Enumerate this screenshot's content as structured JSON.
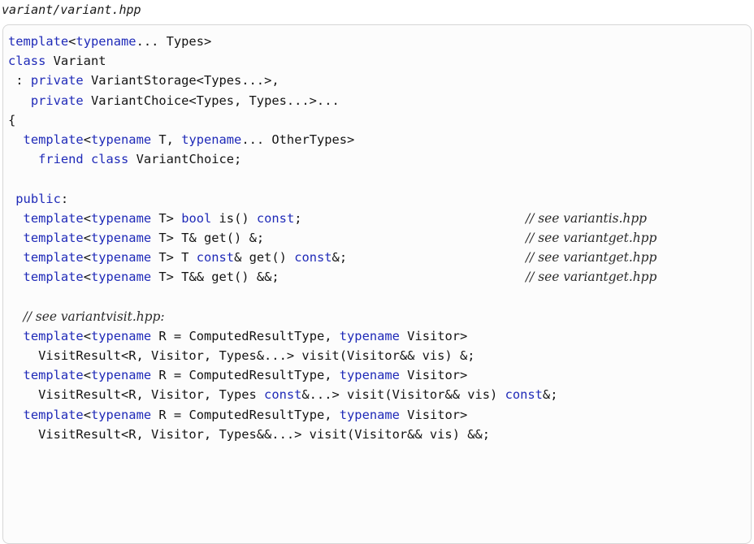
{
  "file": {
    "name": "variant/variant.hpp"
  },
  "code_lines": [
    [
      {
        "t": "template",
        "k": "kw"
      },
      {
        "t": "<",
        "k": "p"
      },
      {
        "t": "typename",
        "k": "kw"
      },
      {
        "t": "... Types>",
        "k": "p"
      }
    ],
    [
      {
        "t": "class",
        "k": "kw"
      },
      {
        "t": " Variant",
        "k": "p"
      }
    ],
    [
      {
        "t": " : ",
        "k": "p"
      },
      {
        "t": "private",
        "k": "kw"
      },
      {
        "t": " VariantStorage<Types...>,",
        "k": "p"
      }
    ],
    [
      {
        "t": "   ",
        "k": "p"
      },
      {
        "t": "private",
        "k": "kw"
      },
      {
        "t": " VariantChoice<Types, Types...>...",
        "k": "p"
      }
    ],
    [
      {
        "t": "{",
        "k": "p"
      }
    ],
    [
      {
        "t": "  ",
        "k": "p"
      },
      {
        "t": "template",
        "k": "kw"
      },
      {
        "t": "<",
        "k": "p"
      },
      {
        "t": "typename",
        "k": "kw"
      },
      {
        "t": " T, ",
        "k": "p"
      },
      {
        "t": "typename",
        "k": "kw"
      },
      {
        "t": "... OtherTypes>",
        "k": "p"
      }
    ],
    [
      {
        "t": "    ",
        "k": "p"
      },
      {
        "t": "friend",
        "k": "kw"
      },
      {
        "t": " ",
        "k": "p"
      },
      {
        "t": "class",
        "k": "kw"
      },
      {
        "t": " VariantChoice;",
        "k": "p"
      }
    ],
    [],
    [
      {
        "t": " ",
        "k": "p"
      },
      {
        "t": "public",
        "k": "kw"
      },
      {
        "t": ":",
        "k": "p"
      }
    ],
    [
      {
        "t": "  ",
        "k": "p"
      },
      {
        "t": "template",
        "k": "kw"
      },
      {
        "t": "<",
        "k": "p"
      },
      {
        "t": "typename",
        "k": "kw"
      },
      {
        "t": " T> ",
        "k": "p"
      },
      {
        "t": "bool",
        "k": "kw"
      },
      {
        "t": " is() ",
        "k": "p"
      },
      {
        "t": "const",
        "k": "kw"
      },
      {
        "t": ";",
        "k": "p"
      },
      {
        "t": "// see variantis.hpp",
        "k": "cm"
      }
    ],
    [
      {
        "t": "  ",
        "k": "p"
      },
      {
        "t": "template",
        "k": "kw"
      },
      {
        "t": "<",
        "k": "p"
      },
      {
        "t": "typename",
        "k": "kw"
      },
      {
        "t": " T> T& get() &;",
        "k": "p"
      },
      {
        "t": "// see variantget.hpp",
        "k": "cm"
      }
    ],
    [
      {
        "t": "  ",
        "k": "p"
      },
      {
        "t": "template",
        "k": "kw"
      },
      {
        "t": "<",
        "k": "p"
      },
      {
        "t": "typename",
        "k": "kw"
      },
      {
        "t": " T> T ",
        "k": "p"
      },
      {
        "t": "const",
        "k": "kw"
      },
      {
        "t": "& get() ",
        "k": "p"
      },
      {
        "t": "const",
        "k": "kw"
      },
      {
        "t": "&;",
        "k": "p"
      },
      {
        "t": "// see variantget.hpp",
        "k": "cm"
      }
    ],
    [
      {
        "t": "  ",
        "k": "p"
      },
      {
        "t": "template",
        "k": "kw"
      },
      {
        "t": "<",
        "k": "p"
      },
      {
        "t": "typename",
        "k": "kw"
      },
      {
        "t": " T> T&& get() &&;",
        "k": "p"
      },
      {
        "t": "// see variantget.hpp",
        "k": "cm"
      }
    ],
    [],
    [
      {
        "t": "  ",
        "k": "p"
      },
      {
        "t": "// see variantvisit.hpp:",
        "k": "cm-inline"
      }
    ],
    [
      {
        "t": "  ",
        "k": "p"
      },
      {
        "t": "template",
        "k": "kw"
      },
      {
        "t": "<",
        "k": "p"
      },
      {
        "t": "typename",
        "k": "kw"
      },
      {
        "t": " R = ComputedResultType, ",
        "k": "p"
      },
      {
        "t": "typename",
        "k": "kw"
      },
      {
        "t": " Visitor>",
        "k": "p"
      }
    ],
    [
      {
        "t": "    VisitResult<R, Visitor, Types&...> visit(Visitor&& vis) &;",
        "k": "p"
      }
    ],
    [
      {
        "t": "  ",
        "k": "p"
      },
      {
        "t": "template",
        "k": "kw"
      },
      {
        "t": "<",
        "k": "p"
      },
      {
        "t": "typename",
        "k": "kw"
      },
      {
        "t": " R = ComputedResultType, ",
        "k": "p"
      },
      {
        "t": "typename",
        "k": "kw"
      },
      {
        "t": " Visitor>",
        "k": "p"
      }
    ],
    [
      {
        "t": "    VisitResult<R, Visitor, Types ",
        "k": "p"
      },
      {
        "t": "const",
        "k": "kw"
      },
      {
        "t": "&...> visit(Visitor&& vis) ",
        "k": "p"
      },
      {
        "t": "const",
        "k": "kw"
      },
      {
        "t": "&;",
        "k": "p"
      }
    ],
    [
      {
        "t": "  ",
        "k": "p"
      },
      {
        "t": "template",
        "k": "kw"
      },
      {
        "t": "<",
        "k": "p"
      },
      {
        "t": "typename",
        "k": "kw"
      },
      {
        "t": " R = ComputedResultType, ",
        "k": "p"
      },
      {
        "t": "typename",
        "k": "kw"
      },
      {
        "t": " Visitor>",
        "k": "p"
      }
    ],
    [
      {
        "t": "    VisitResult<R, Visitor, Types&&...> visit(Visitor&& vis) &&;",
        "k": "p"
      }
    ],
    []
  ]
}
